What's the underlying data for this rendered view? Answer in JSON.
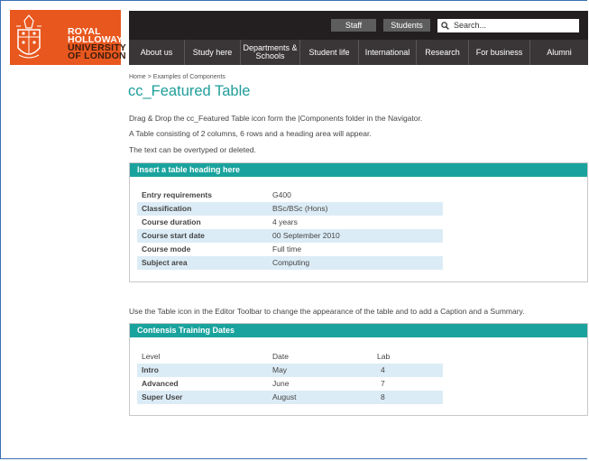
{
  "logo": {
    "line1": "ROYAL",
    "line2": "HOLLOWAY",
    "line3": "UNIVERSITY",
    "line4": "OF LONDON",
    "brand_color": "#e8571e"
  },
  "topbar": {
    "staff_label": "Staff",
    "students_label": "Students",
    "search_placeholder": "Search...",
    "search_icon": "search-icon"
  },
  "nav": {
    "items": [
      {
        "label": "About us"
      },
      {
        "label": "Study here"
      },
      {
        "label": "Departments & Schools"
      },
      {
        "label": "Student life"
      },
      {
        "label": "International"
      },
      {
        "label": "Research"
      },
      {
        "label": "For business"
      },
      {
        "label": "Alumni"
      }
    ]
  },
  "breadcrumb": {
    "home": "Home",
    "separator": ">",
    "current": "Examples of Components"
  },
  "page": {
    "title": "cc_Featured Table",
    "paragraphs": [
      "Drag & Drop the cc_Featured Table icon form the |Components folder in the Navigator.",
      "A Table consisting of 2 columns, 6 rows and a heading area will appear.",
      "The text can be overtyped or deleted."
    ],
    "mid_paragraph": "Use the Table icon in the Editor Toolbar to change the appearance of the table and to add a Caption and a Summary.",
    "accent_color": "#1aa39e"
  },
  "table1": {
    "heading": "Insert a table heading here",
    "rows": [
      {
        "label": "Entry requirements",
        "value": "G400"
      },
      {
        "label": "Classification",
        "value": "BSc/BSc (Hons)"
      },
      {
        "label": "Course duration",
        "value": "4 years"
      },
      {
        "label": "Course start date",
        "value": "00 September 2010"
      },
      {
        "label": "Course mode",
        "value": "Full time"
      },
      {
        "label": "Subject area",
        "value": "Computing"
      }
    ]
  },
  "table2": {
    "heading": "Contensis Training Dates",
    "columns": [
      "Level",
      "Date",
      "Lab"
    ],
    "rows": [
      {
        "level": "Intro",
        "date": "May",
        "lab": "4"
      },
      {
        "level": "Advanced",
        "date": "June",
        "lab": "7"
      },
      {
        "level": "Super User",
        "date": "August",
        "lab": "8"
      }
    ]
  }
}
